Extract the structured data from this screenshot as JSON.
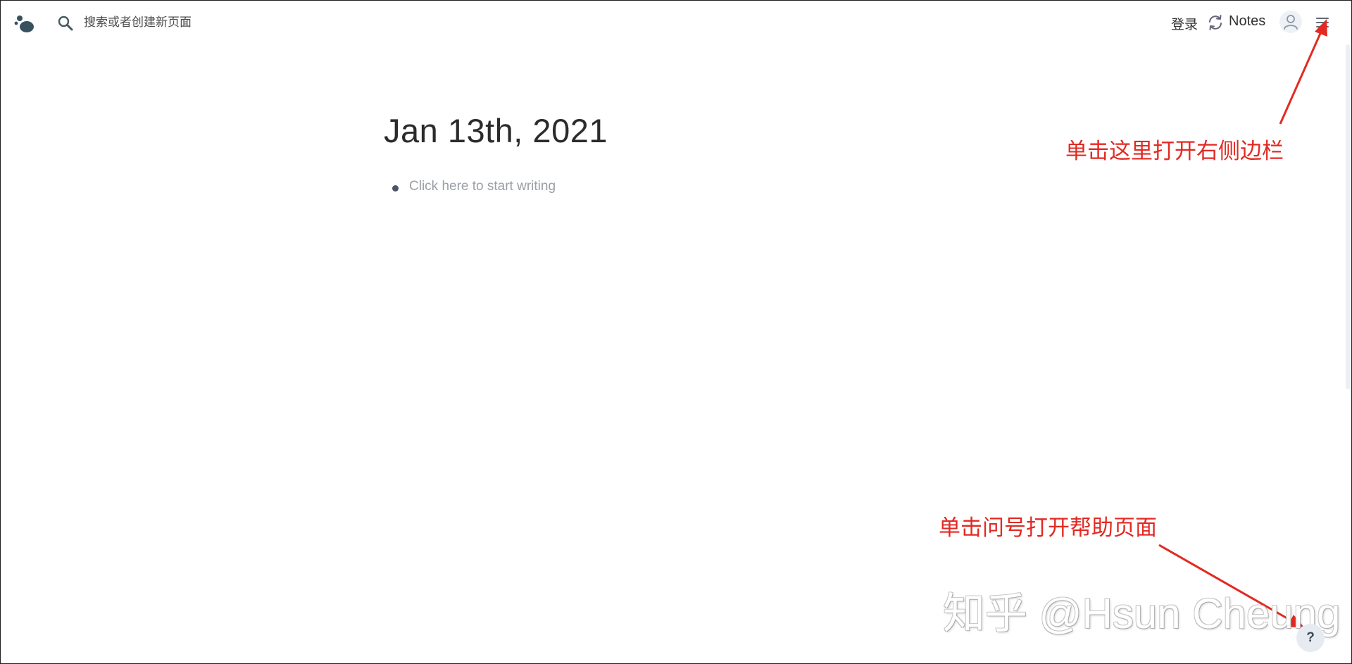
{
  "header": {
    "search_placeholder": "搜索或者创建新页面",
    "login_label": "登录",
    "notes_label": "Notes"
  },
  "page": {
    "title": "Jan 13th, 2021",
    "bullets": [
      {
        "placeholder": "Click here to start writing"
      }
    ]
  },
  "annotations": {
    "sidebar_hint": "单击这里打开右侧边栏",
    "help_hint": "单击问号打开帮助页面"
  },
  "watermark": {
    "text": "知乎 @Hsun Cheung"
  },
  "help_button": {
    "label": "?"
  },
  "colors": {
    "annotation": "#e22a23",
    "text_primary": "#2b2b2b",
    "placeholder": "#9aa0a6",
    "icon": "#455a64"
  },
  "icons": {
    "logo": "logseq-logo-icon",
    "search": "search-icon",
    "sync": "sync-icon",
    "avatar": "user-avatar-icon",
    "menu": "menu-icon"
  }
}
